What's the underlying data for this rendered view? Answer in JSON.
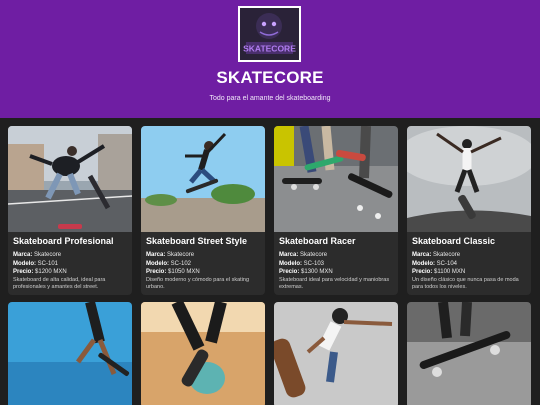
{
  "header": {
    "logo_text": "SKATECORE",
    "title": "SKATECORE",
    "tagline": "Todo para el amante del skateboarding"
  },
  "labels": {
    "brand": "Marca:",
    "model": "Modelo:",
    "price": "Precio:"
  },
  "products": [
    {
      "name": "Skateboard Profesional",
      "brand": "Skatecore",
      "model": "SC-101",
      "price": "$1200 MXN",
      "description": "Skateboard de alta calidad, ideal para profesionales y amantes del street."
    },
    {
      "name": "Skateboard Street Style",
      "brand": "Skatecore",
      "model": "SC-102",
      "price": "$1050 MXN",
      "description": "Diseño moderno y cómodo para el skating urbano."
    },
    {
      "name": "Skateboard Racer",
      "brand": "Skatecore",
      "model": "SC-103",
      "price": "$1300 MXN",
      "description": "Skateboard ideal para velocidad y maniobras extremas."
    },
    {
      "name": "Skateboard Classic",
      "brand": "Skatecore",
      "model": "SC-104",
      "price": "$1100 MXN",
      "description": "Un diseño clásico que nunca pasa de moda para todos los niveles."
    }
  ],
  "colors": {
    "header_bg": "#6f1ea3",
    "page_bg": "#1f1f1f",
    "card_bg": "#2c2c2c"
  }
}
